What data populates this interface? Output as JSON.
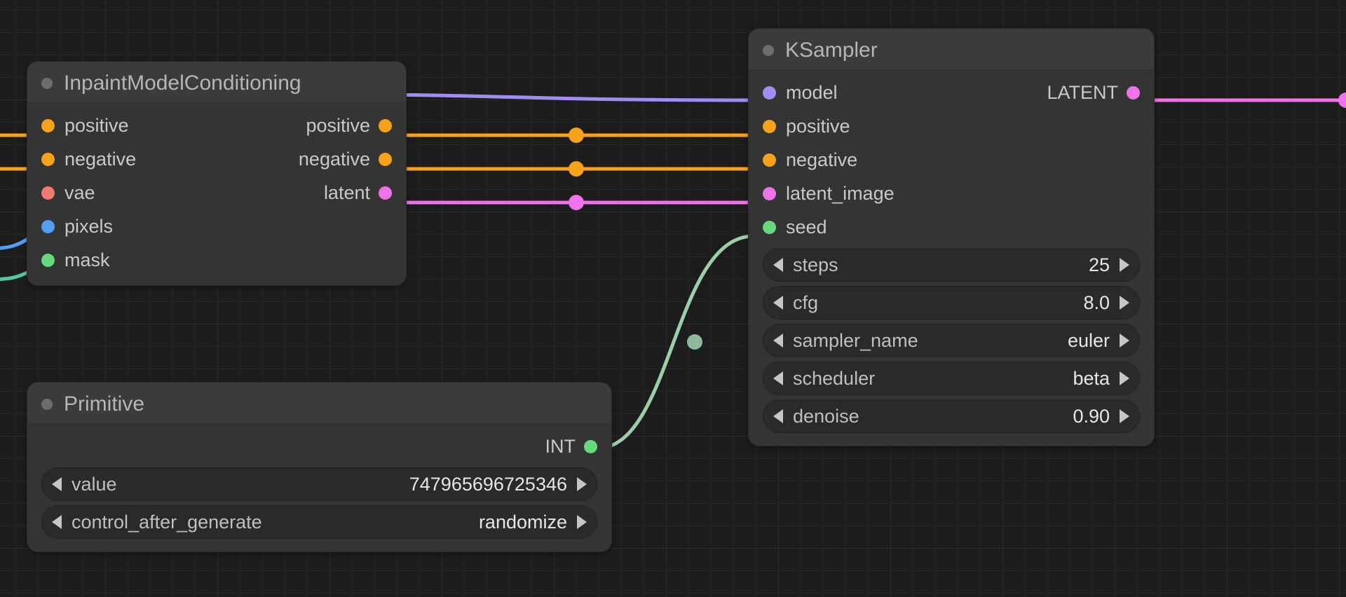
{
  "nodes": {
    "inpaint": {
      "title": "InpaintModelConditioning",
      "inputs": {
        "positive": "positive",
        "negative": "negative",
        "vae": "vae",
        "pixels": "pixels",
        "mask": "mask"
      },
      "outputs": {
        "positive": "positive",
        "negative": "negative",
        "latent": "latent"
      }
    },
    "primitive": {
      "title": "Primitive",
      "outputs": {
        "int": "INT"
      },
      "widgets": {
        "value": {
          "label": "value",
          "value": "747965696725346"
        },
        "control_after_generate": {
          "label": "control_after_generate",
          "value": "randomize"
        }
      }
    },
    "ksampler": {
      "title": "KSampler",
      "inputs": {
        "model": "model",
        "positive": "positive",
        "negative": "negative",
        "latent_image": "latent_image",
        "seed": "seed"
      },
      "outputs": {
        "latent": "LATENT"
      },
      "widgets": {
        "steps": {
          "label": "steps",
          "value": "25"
        },
        "cfg": {
          "label": "cfg",
          "value": "8.0"
        },
        "sampler_name": {
          "label": "sampler_name",
          "value": "euler"
        },
        "scheduler": {
          "label": "scheduler",
          "value": "beta"
        },
        "denoise": {
          "label": "denoise",
          "value": "0.90"
        }
      }
    }
  },
  "colors": {
    "orange": "#f8a11b",
    "red": "#f07a6d",
    "blue": "#4f9ff5",
    "green": "#66d97a",
    "purple": "#a38cf1",
    "pink": "#f072ea",
    "mint": "#9bcfa9"
  }
}
